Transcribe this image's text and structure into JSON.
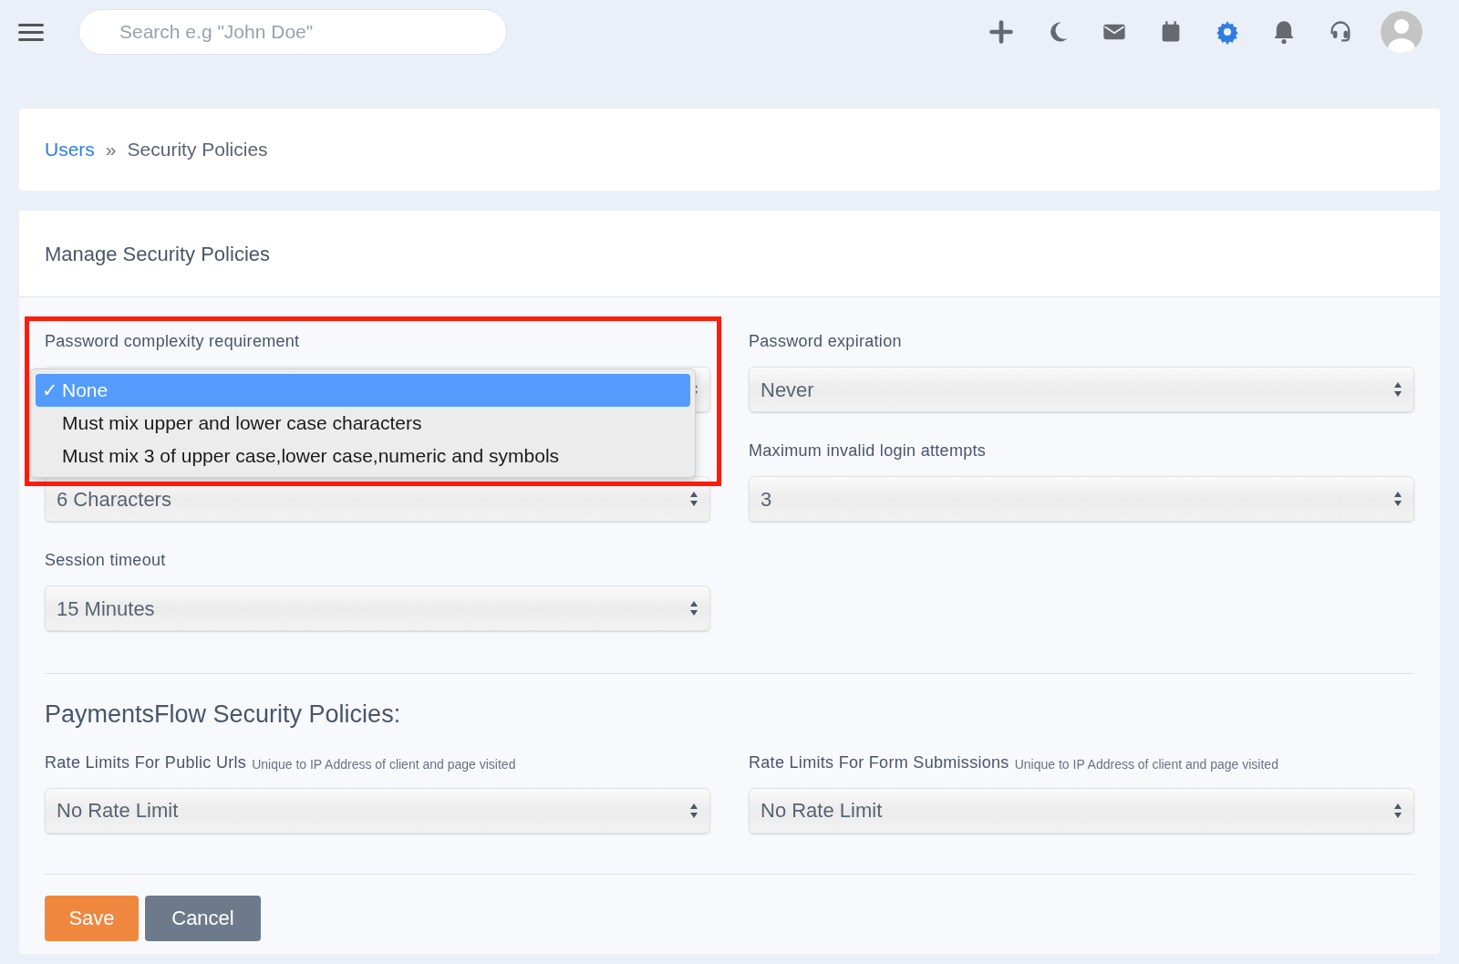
{
  "topbar": {
    "search": {
      "placeholder": "Search e.g \"John Doe\""
    },
    "icons": [
      {
        "kind": "plus",
        "active": false
      },
      {
        "kind": "moon",
        "active": false
      },
      {
        "kind": "mail",
        "active": false
      },
      {
        "kind": "calendar",
        "active": false
      },
      {
        "kind": "gear",
        "active": true
      },
      {
        "kind": "bell",
        "active": false
      },
      {
        "kind": "headset",
        "active": false
      }
    ]
  },
  "breadcrumb": {
    "link": "Users",
    "separator": "»",
    "current": "Security Policies"
  },
  "card": {
    "title": "Manage Security Policies",
    "fields": [
      {
        "label": "Password complexity requirement"
      },
      {
        "label": "Password expiration",
        "value": "Never"
      },
      {
        "value": "6 Characters"
      },
      {
        "label": "Maximum invalid login attempts",
        "value": "3"
      },
      {
        "label": "Session timeout",
        "value": "15 Minutes"
      }
    ],
    "dropdown": {
      "options": [
        {
          "label": "None",
          "selected": true
        },
        {
          "label": "Must mix upper and lower case characters",
          "selected": false
        },
        {
          "label": "Must mix 3 of upper case,lower case,numeric and symbols",
          "selected": false
        }
      ],
      "check": "✓"
    },
    "section_title": "PaymentsFlow Security Policies:",
    "rate_fields": [
      {
        "label": "Rate Limits For Public Urls",
        "hint": "Unique to IP Address of client and page visited",
        "value": "No Rate Limit"
      },
      {
        "label": "Rate Limits For Form Submissions",
        "hint": "Unique to IP Address of client and page visited",
        "value": "No Rate Limit"
      }
    ],
    "buttons": [
      {
        "label": "Save",
        "kind": "primary"
      },
      {
        "label": "Cancel",
        "kind": "secondary"
      }
    ]
  },
  "annotation": {
    "highlight": true
  }
}
